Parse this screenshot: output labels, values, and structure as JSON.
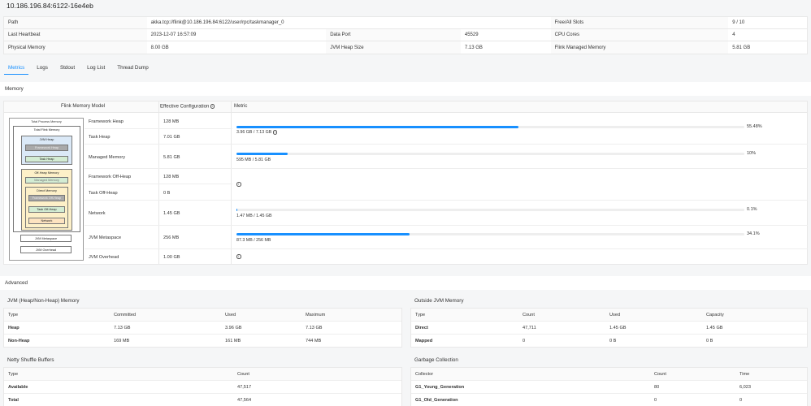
{
  "title": "10.186.196.84:6122-16e4eb",
  "info": {
    "path_label": "Path",
    "path_value": "akka.tcp://flink@10.186.196.84:6122/user/rpc/taskmanager_0",
    "slots_label": "Free/All Slots",
    "slots_value": "9 / 10",
    "heartbeat_label": "Last Heartbeat",
    "heartbeat_value": "2023-12-07 16:57:09",
    "dataport_label": "Data Port",
    "dataport_value": "45529",
    "cpu_label": "CPU Cores",
    "cpu_value": "4",
    "physmem_label": "Physical Memory",
    "physmem_value": "8.00 GB",
    "heap_label": "JVM Heap Size",
    "heap_value": "7.13 GB",
    "managed_label": "Flink Managed Memory",
    "managed_value": "5.81 GB"
  },
  "tabs": [
    "Metrics",
    "Logs",
    "Stdout",
    "Log List",
    "Thread Dump"
  ],
  "memory_section": "Memory",
  "memory_table": {
    "col_model": "Flink Memory Model",
    "col_config": "Effective Configuration",
    "col_metric": "Metric",
    "rows": [
      {
        "name": "Framework Heap",
        "value": "128 MB"
      },
      {
        "name": "Task Heap",
        "value": "7.01 GB"
      },
      {
        "name": "Managed Memory",
        "value": "5.81 GB"
      },
      {
        "name": "Framework Off-Heap",
        "value": "128 MB"
      },
      {
        "name": "Task Off-Heap",
        "value": "0 B"
      },
      {
        "name": "Network",
        "value": "1.45 GB"
      },
      {
        "name": "JVM Metaspace",
        "value": "256 MB"
      },
      {
        "name": "JVM Overhead",
        "value": "1.00 GB"
      }
    ],
    "metrics": {
      "heap": {
        "percent": 55.48,
        "percent_label": "55.48%",
        "usage": "3.96 GB / 7.13 GB"
      },
      "managed": {
        "percent": 10,
        "percent_label": "10%",
        "usage": "595 MB / 5.81 GB"
      },
      "network": {
        "percent": 0.1,
        "percent_label": "0.1%",
        "usage": "1.47 MB / 1.45 GB"
      },
      "metaspace": {
        "percent": 34.1,
        "percent_label": "34.1%",
        "usage": "87.3 MB / 256 MB"
      }
    }
  },
  "diagram": {
    "total_process": "Total Process Memory",
    "total_flink": "Total Flink Memory",
    "jvm_heap": "JVM Heap",
    "framework_heap": "Framework Heap",
    "task_heap": "Task Heap",
    "off_heap": "Off-Heap Memory",
    "managed": "Managed Memory",
    "direct": "Direct Memory",
    "framework_off_heap": "Framework Off-Heap",
    "task_off_heap": "Task Off-Heap",
    "network": "Network",
    "metaspace": "JVM Metaspace",
    "overhead": "JVM Overhead"
  },
  "advanced_section": "Advanced",
  "jvm_mem": {
    "title": "JVM (Heap/Non-Heap) Memory",
    "headers": [
      "Type",
      "Committed",
      "Used",
      "Maximum"
    ],
    "rows": [
      [
        "Heap",
        "7.13 GB",
        "3.96 GB",
        "7.13 GB"
      ],
      [
        "Non-Heap",
        "169 MB",
        "161 MB",
        "744 MB"
      ]
    ]
  },
  "outside_mem": {
    "title": "Outside JVM Memory",
    "headers": [
      "Type",
      "Count",
      "Used",
      "Capacity"
    ],
    "rows": [
      [
        "Direct",
        "47,711",
        "1.45 GB",
        "1.45 GB"
      ],
      [
        "Mapped",
        "0",
        "0 B",
        "0 B"
      ]
    ]
  },
  "netty": {
    "title": "Netty Shuffle Buffers",
    "headers": [
      "Type",
      "Count"
    ],
    "rows": [
      [
        "Available",
        "47,517"
      ],
      [
        "Total",
        "47,564"
      ]
    ]
  },
  "gc": {
    "title": "Garbage Collection",
    "headers": [
      "Collector",
      "Count",
      "Time"
    ],
    "rows": [
      [
        "G1_Young_Generation",
        "80",
        "6,023"
      ],
      [
        "G1_Old_Generation",
        "0",
        "0"
      ]
    ]
  },
  "colors": {
    "accent": "#1890ff",
    "heap_box": "#dbe9f7",
    "offheap_box": "#fdf0c8",
    "inner_grey": "#a9a9a9",
    "green_box": "#d3ecd3",
    "orange_box": "#fde3c0"
  }
}
